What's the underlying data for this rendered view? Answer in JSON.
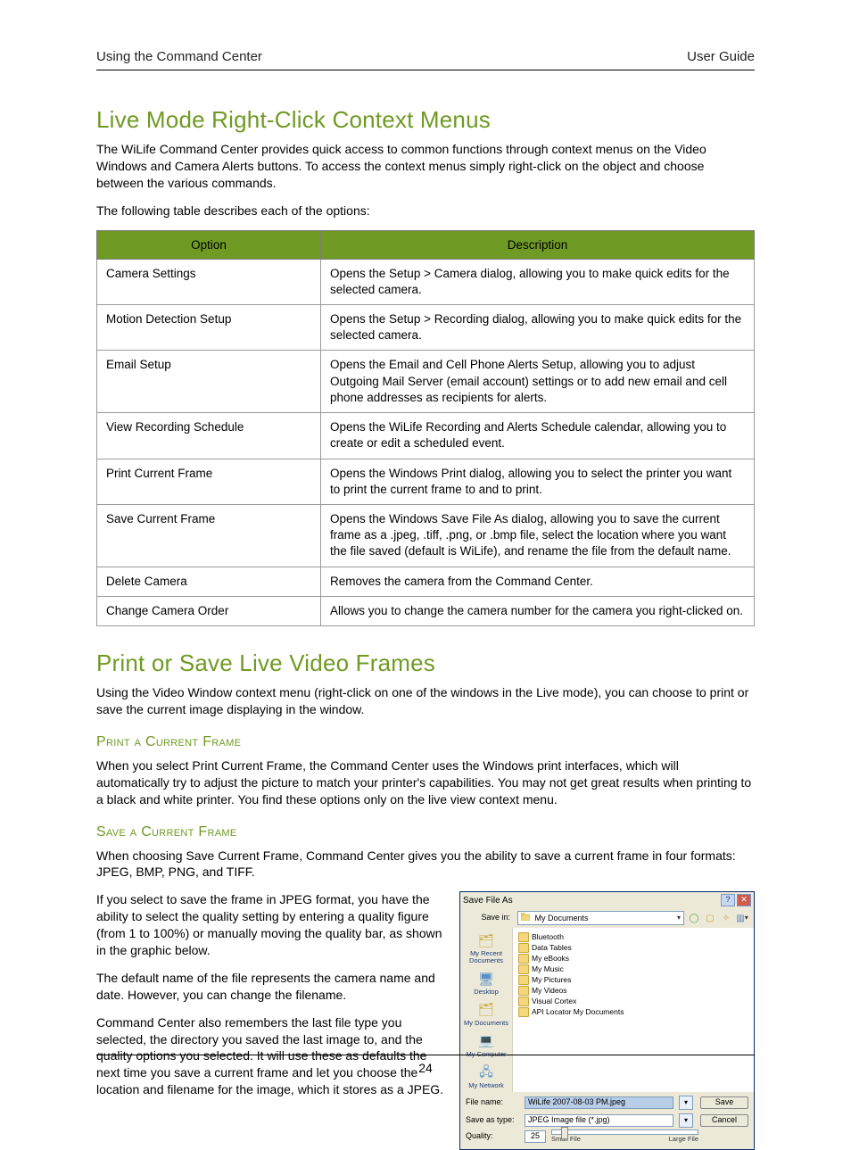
{
  "header": {
    "left": "Using the Command Center",
    "right": "User Guide"
  },
  "section1": {
    "title": "Live Mode Right-Click Context Menus",
    "intro": "The WiLife Command Center provides quick access to common functions through context menus on the Video Windows and Camera Alerts buttons. To access the context menus simply right-click on the object and choose between the various commands.",
    "lead": "The following table describes each of the options:",
    "table": {
      "headers": {
        "option": "Option",
        "description": "Description"
      },
      "rows": [
        {
          "option": "Camera Settings",
          "description": "Opens the Setup > Camera dialog, allowing you to make quick edits for the selected camera."
        },
        {
          "option": "Motion Detection Setup",
          "description": "Opens the Setup > Recording dialog, allowing you to make quick edits for the selected camera."
        },
        {
          "option": "Email Setup",
          "description": "Opens the Email and Cell Phone Alerts Setup, allowing you to adjust Outgoing Mail Server (email account) settings or to add new email and cell phone addresses as recipients for alerts."
        },
        {
          "option": "View Recording Schedule",
          "description": "Opens the WiLife Recording and Alerts Schedule calendar, allowing you to create or edit a scheduled event."
        },
        {
          "option": "Print Current Frame",
          "description": "Opens the Windows Print dialog, allowing you to select the printer you want to print the current frame to and to print."
        },
        {
          "option": "Save Current Frame",
          "description": "Opens the Windows Save File As dialog, allowing you to save the current frame as a .jpeg, .tiff, .png, or .bmp file, select the location where you want the file saved (default is WiLife), and rename the file from the default name."
        },
        {
          "option": "Delete Camera",
          "description": "Removes the camera from the Command Center."
        },
        {
          "option": "Change Camera Order",
          "description": "Allows you to change the camera number for the camera you right-clicked on."
        }
      ]
    }
  },
  "section2": {
    "title": "Print or Save Live Video Frames",
    "intro": "Using the Video Window context menu (right-click on one of the windows in the Live mode), you can choose to print or save the current image displaying in the window.",
    "sub1": {
      "heading": "Print a Current Frame",
      "text": "When you select Print Current Frame, the Command Center uses the Windows print interfaces, which will automatically try to adjust the picture to match your printer's capabilities.  You may not get great results when printing to a black and white printer. You find these options only on the live view context menu."
    },
    "sub2": {
      "heading": "Save a Current Frame",
      "p1": "When choosing Save Current Frame, Command Center gives you the ability to save a current frame in four formats: JPEG, BMP, PNG, and TIFF.",
      "p2": "If you select to save the frame in JPEG format, you have the ability to select the quality setting by entering a quality figure (from 1 to 100%) or manually moving the quality bar, as shown in the graphic below.",
      "p3": "The default name of the file represents the camera name and date. However, you can change the filename.",
      "p4": "Command Center also remembers the last file type you selected, the directory you saved the last image to, and the quality options you selected.  It will use these as defaults the next time you save a current frame and let you choose the location and filename for the image, which it stores as a JPEG."
    }
  },
  "saveas": {
    "title": "Save File As",
    "savein_label": "Save in:",
    "savein_value": "My Documents",
    "places": {
      "recent": "My Recent Documents",
      "desktop": "Desktop",
      "documents": "My Documents",
      "computer": "My Computer",
      "network": "My Network"
    },
    "list": [
      "Bluetooth",
      "Data Tables",
      "My eBooks",
      "My Music",
      "My Pictures",
      "My Videos",
      "Visual Cortex",
      "API Locator My Documents"
    ],
    "filename_label": "File name:",
    "filename_value": "WiLife 2007-08-03 PM.jpeg",
    "saveastype_label": "Save as type:",
    "saveastype_value": "JPEG Image file (*.jpg)",
    "quality_label": "Quality:",
    "quality_value": "25",
    "small": "Small File",
    "large": "Large File",
    "save_btn": "Save",
    "cancel_btn": "Cancel"
  },
  "page_number": "24"
}
